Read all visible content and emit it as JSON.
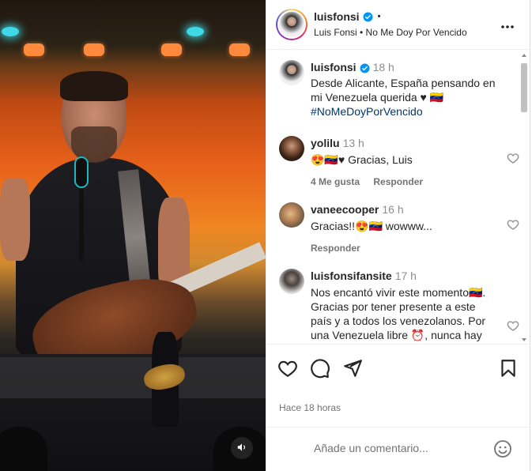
{
  "post": {
    "username": "luisfonsi",
    "separator": "•",
    "subtitle": "Luis Fonsi • No Me Doy Por Vencido",
    "posted_ago": "Hace 18 horas"
  },
  "caption": {
    "username": "luisfonsi",
    "time": "18 h",
    "text": "Desde Alicante, España pensando en mi Venezuela querida ♥ 🇻🇪",
    "hashtag": "#NoMeDoyPorVencido"
  },
  "comments": [
    {
      "username": "yolilu",
      "time": "13 h",
      "text": "😍🇻🇪♥ Gracias, Luis",
      "likes": "4 Me gusta",
      "reply": "Responder"
    },
    {
      "username": "vaneecooper",
      "time": "16 h",
      "text": "Gracias!!😍🇻🇪 wowww...",
      "reply": "Responder"
    },
    {
      "username": "luisfonsifansite",
      "time": "17 h",
      "text": "Nos encantó vivir este momento🇻🇪. Gracias por tener presente a este país y a todos los venezolanos. Por una Venezuela libre ⏰, nunca hay que darse por vencido, todo"
    }
  ],
  "add_comment": {
    "placeholder": "Añade un comentario..."
  },
  "icons": {
    "header": [
      "verified-badge-icon",
      "more-options-icon"
    ],
    "actions": [
      "heart-icon",
      "comment-icon",
      "share-icon",
      "bookmark-icon"
    ],
    "media": [
      "audio-icon"
    ],
    "input": [
      "emoji-icon"
    ]
  },
  "colors": {
    "verified": "#0095f6",
    "hashtag": "#00376b",
    "secondary_text": "#737373"
  }
}
